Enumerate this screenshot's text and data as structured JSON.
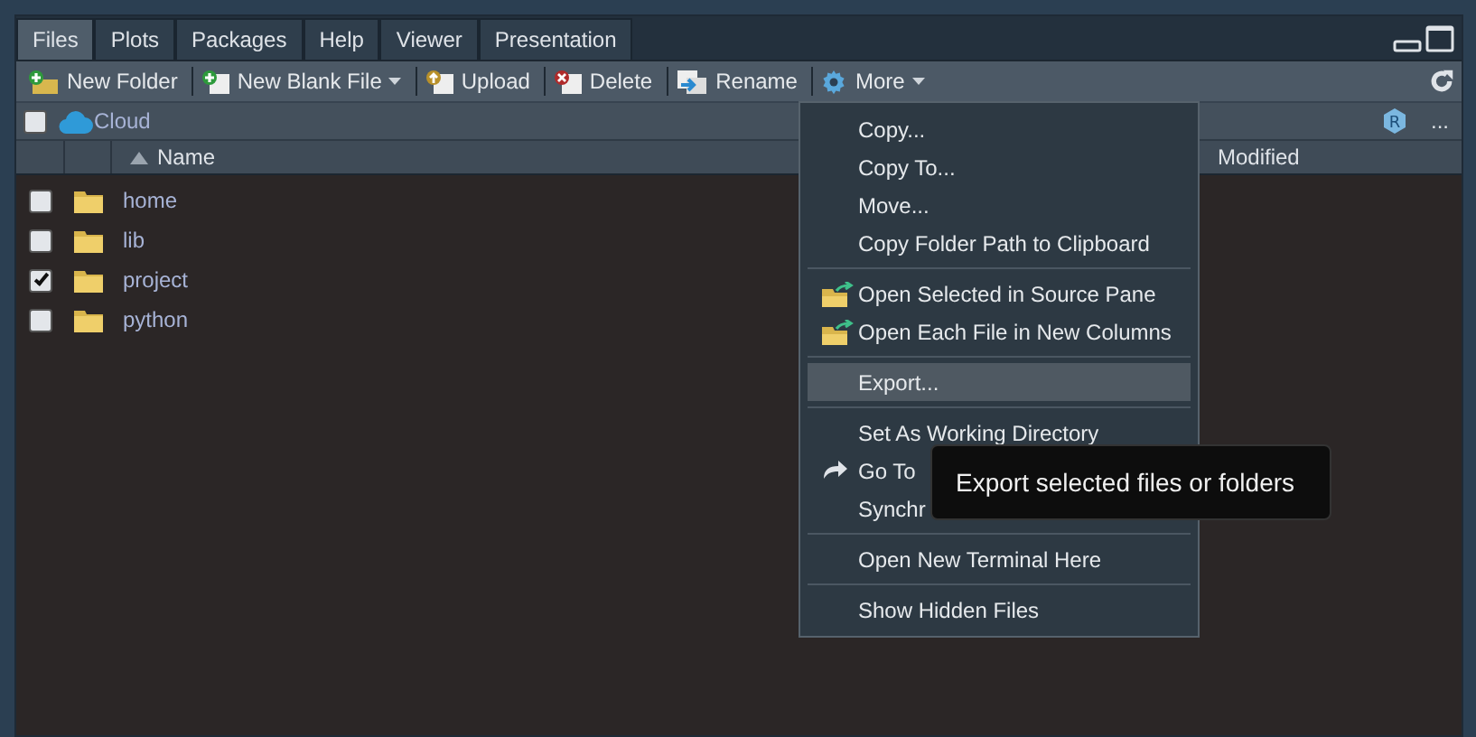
{
  "tabs": [
    {
      "label": "Files",
      "selected": true
    },
    {
      "label": "Plots",
      "selected": false
    },
    {
      "label": "Packages",
      "selected": false
    },
    {
      "label": "Help",
      "selected": false
    },
    {
      "label": "Viewer",
      "selected": false
    },
    {
      "label": "Presentation",
      "selected": false
    }
  ],
  "toolbar": [
    {
      "label": "New Folder",
      "caret": false
    },
    {
      "label": "New Blank File",
      "caret": true
    },
    {
      "label": "Upload",
      "caret": false
    },
    {
      "label": "Delete",
      "caret": false
    },
    {
      "label": "Rename",
      "caret": false
    },
    {
      "label": "More",
      "caret": true
    }
  ],
  "path": {
    "checked": false,
    "label": "Cloud",
    "project_badge": "R",
    "more": "..."
  },
  "columns": [
    {
      "label": "Name",
      "sorted": true
    },
    {
      "label": "Modified",
      "sorted": false
    }
  ],
  "files": [
    {
      "name": "home",
      "checked": false
    },
    {
      "name": "lib",
      "checked": false
    },
    {
      "name": "project",
      "checked": true
    },
    {
      "name": "python",
      "checked": false
    }
  ],
  "menu": [
    {
      "kind": "item",
      "label": "Copy...",
      "selected": false
    },
    {
      "kind": "item",
      "label": "Copy To...",
      "selected": false
    },
    {
      "kind": "item",
      "label": "Move...",
      "selected": false
    },
    {
      "kind": "item",
      "label": "Copy Folder Path to Clipboard",
      "selected": false
    },
    {
      "kind": "separator"
    },
    {
      "kind": "folder-item",
      "label": "Open Selected in Source Pane",
      "selected": false
    },
    {
      "kind": "folder-item",
      "label": "Open Each File in New Columns",
      "selected": false
    },
    {
      "kind": "separator"
    },
    {
      "kind": "item",
      "label": "Export...",
      "selected": true
    },
    {
      "kind": "separator"
    },
    {
      "kind": "item",
      "label": "Set As Working Directory",
      "selected": false
    },
    {
      "kind": "arrow-item",
      "label": "Go To",
      "selected": false
    },
    {
      "kind": "item",
      "label": "Synchr",
      "selected": false
    },
    {
      "kind": "separator"
    },
    {
      "kind": "item",
      "label": "Open New Terminal Here",
      "selected": false
    },
    {
      "kind": "separator"
    },
    {
      "kind": "item",
      "label": "Show Hidden Files",
      "selected": false
    }
  ],
  "tooltip": "Export selected files or folders"
}
